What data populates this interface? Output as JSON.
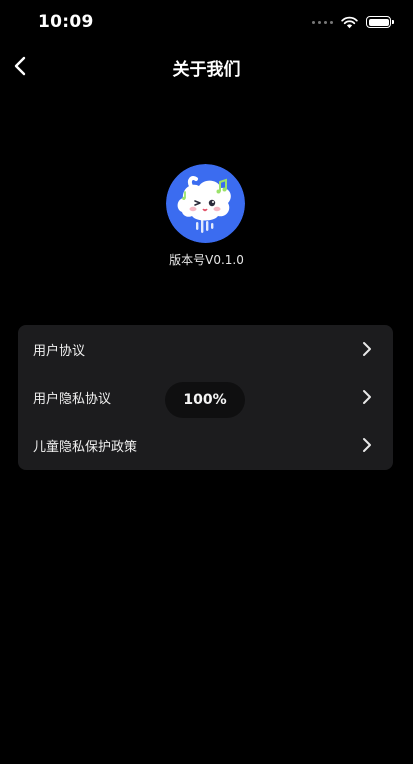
{
  "status_bar": {
    "time": "10:09",
    "battery_level": 1.0
  },
  "nav": {
    "title": "关于我们",
    "back_icon": "chevron-left-icon"
  },
  "app": {
    "version_label": "版本号V0.1.0"
  },
  "menu": {
    "items": [
      {
        "label": "用户协议",
        "icon": "chevron-right-icon"
      },
      {
        "label": "用户隐私协议",
        "icon": "chevron-right-icon"
      },
      {
        "label": "儿童隐私保护政策",
        "icon": "chevron-right-icon"
      }
    ]
  },
  "toast": {
    "text": "100%"
  },
  "colors": {
    "background": "#000000",
    "card": "#1c1c1e",
    "logo_blue": "#3b6cf0"
  }
}
